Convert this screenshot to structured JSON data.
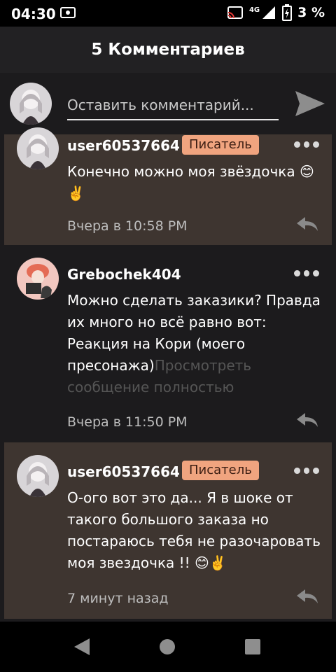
{
  "status_bar": {
    "time": "04:30",
    "network": "4G",
    "battery_text": "3 %"
  },
  "header": {
    "title": "5 Комментариев"
  },
  "compose": {
    "placeholder": "Оставить комментарий..."
  },
  "comments": [
    {
      "username": "user60537664",
      "badge": "Писатель",
      "text": "Конечно можно моя звёздочка 😊✌️",
      "time": "Вчера в 10:58 PM",
      "highlight_color": "#3e3530"
    },
    {
      "username": "Grebochek404",
      "badge": "",
      "text": "Можно сделать заказики? Правда их много но всё равно вот: Реакция на Кори (моего пресонажа)",
      "more_label": "Просмотреть сообщение полностью",
      "time": "Вчера в 11:50 PM"
    },
    {
      "username": "user60537664",
      "badge": "Писатель",
      "text": "О-ого вот это да... Я в шоке от такого большого заказа но постараюсь тебя не разочаровать моя звездочка !! 😊✌️",
      "time": "7 минут назад",
      "highlight_color": "#3e3530"
    }
  ],
  "icons": {
    "send": "send-icon",
    "more": "more-dots-icon",
    "reply": "reply-arrow-icon",
    "nav": [
      "back-icon",
      "home-icon",
      "recents-icon"
    ]
  }
}
